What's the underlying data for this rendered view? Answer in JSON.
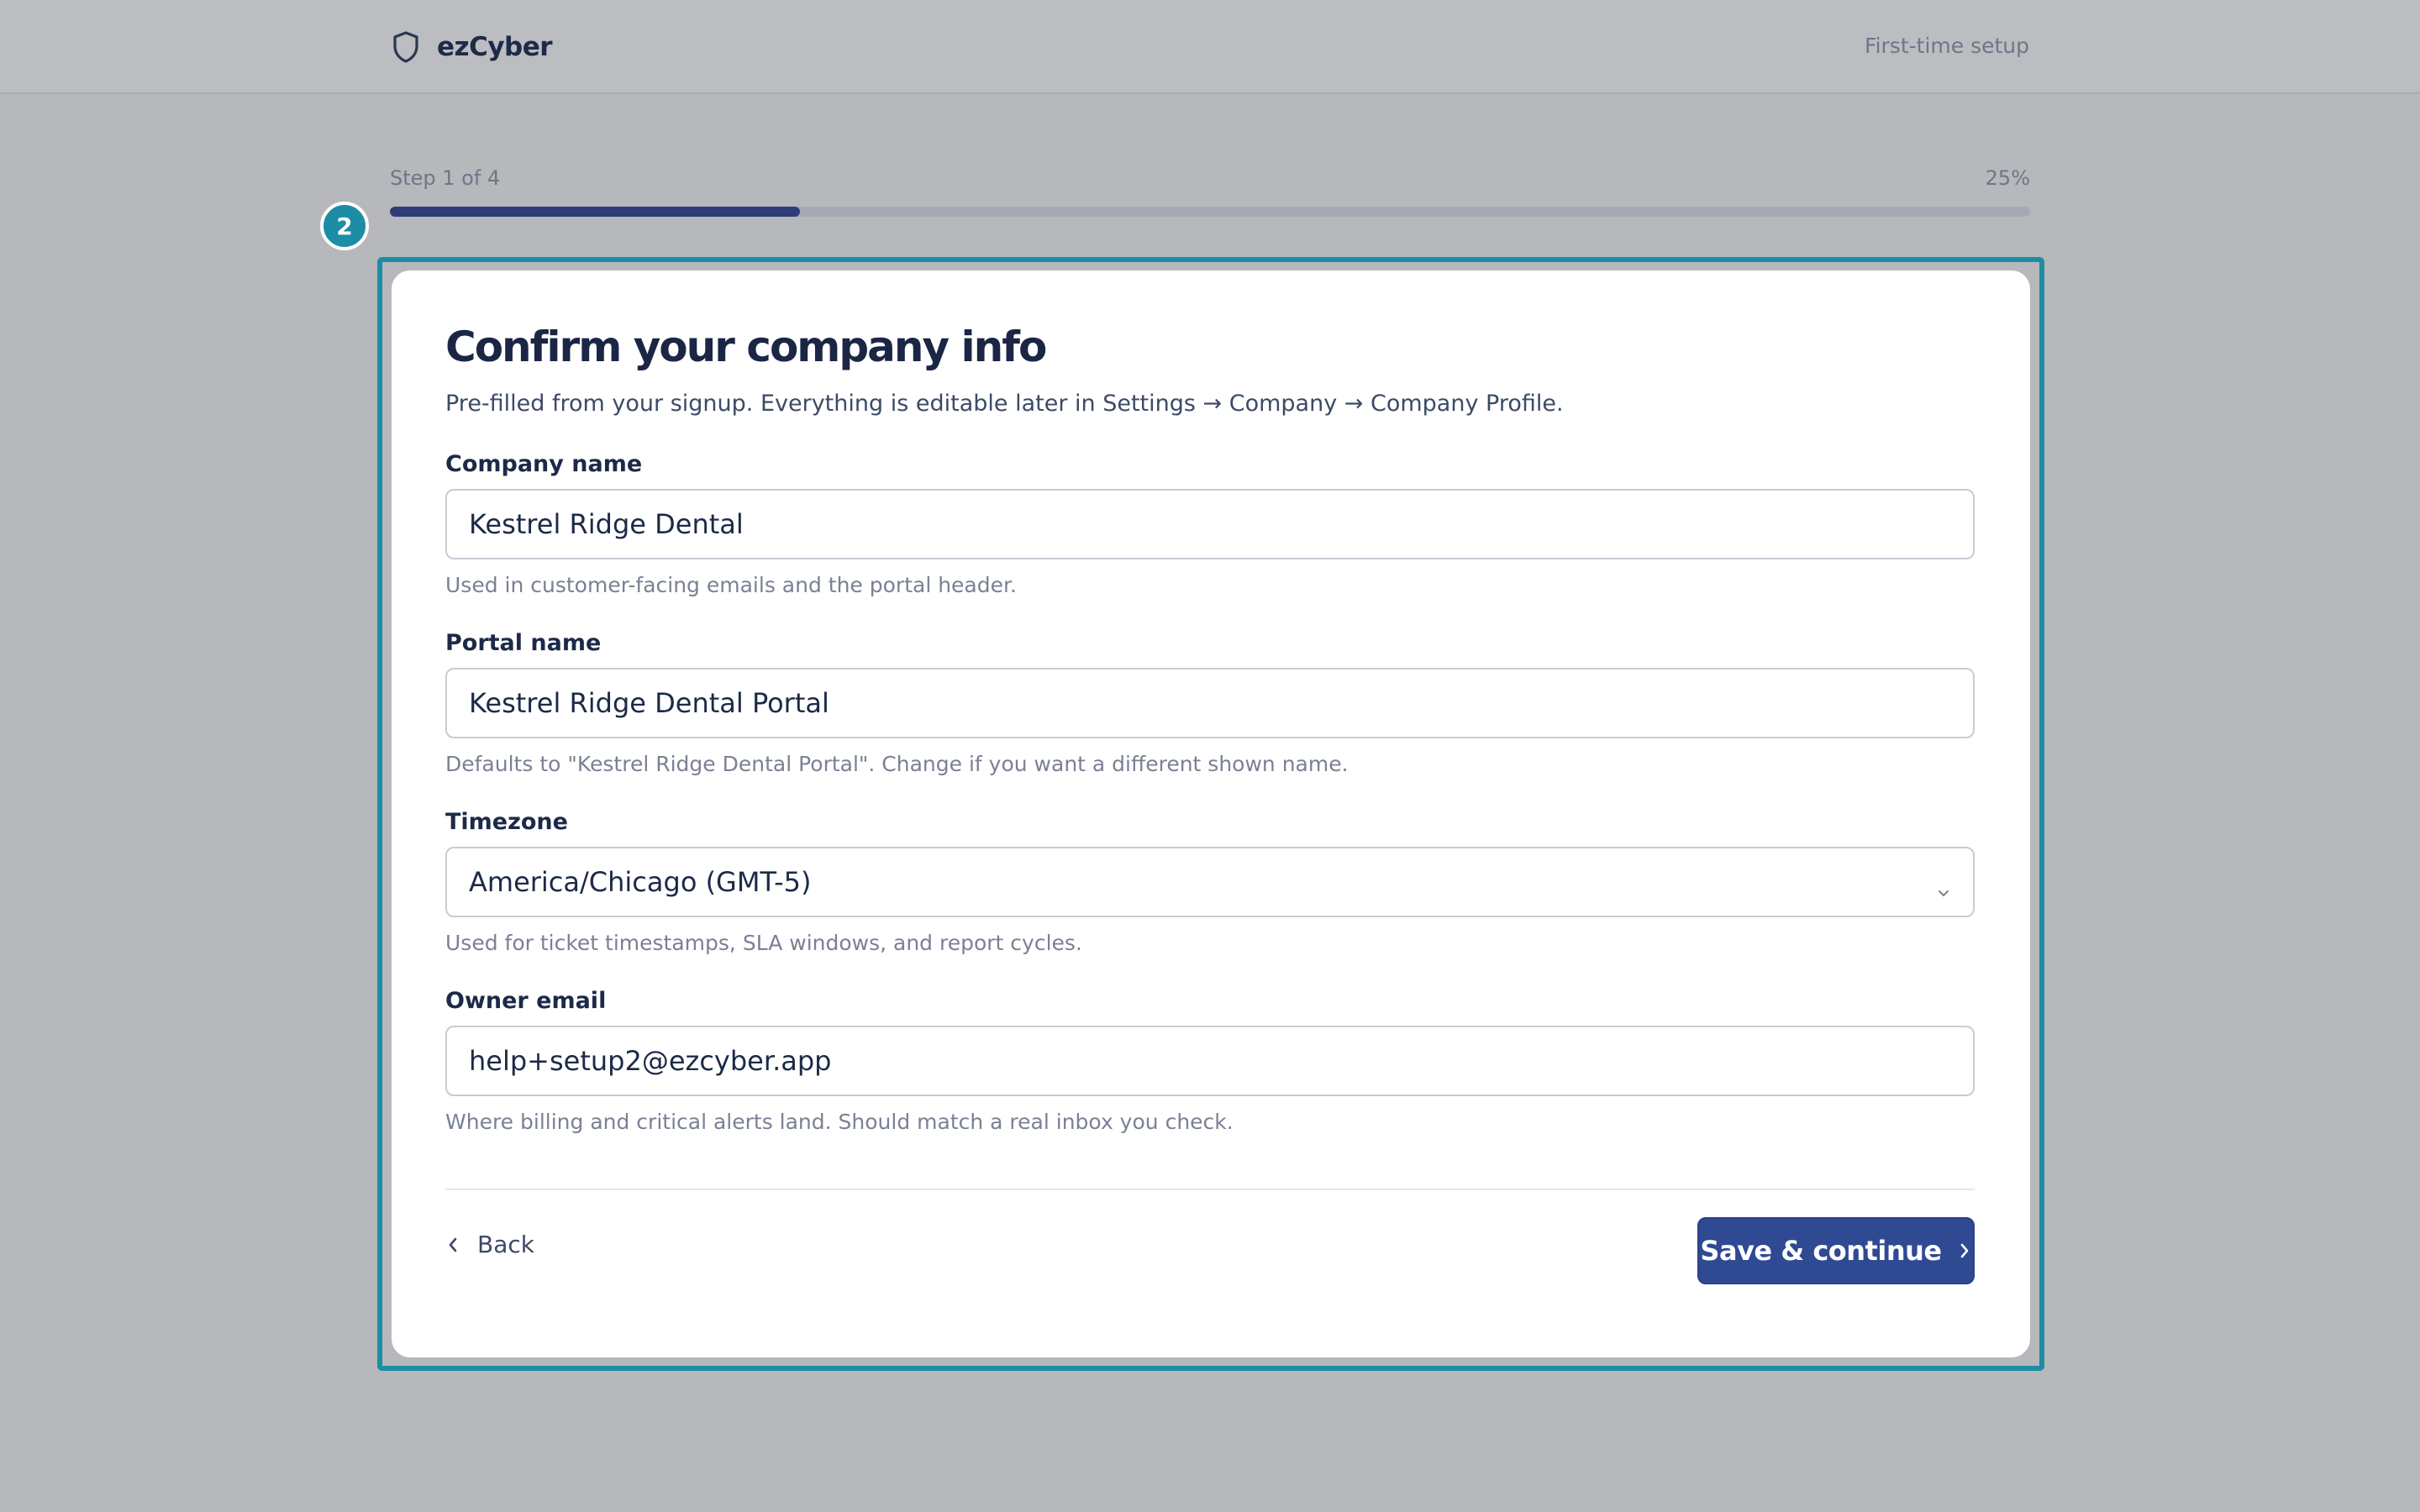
{
  "header": {
    "brand_name": "ezCyber",
    "setup_label": "First-time setup"
  },
  "progress": {
    "step_text": "Step 1 of 4",
    "percent_text": "25%",
    "fraction": 0.25
  },
  "annotation": {
    "badge_number": "2",
    "color": "#1c8da5"
  },
  "form": {
    "title": "Confirm your company info",
    "subtitle": "Pre-filled from your signup. Everything is editable later in Settings → Company → Company Profile.",
    "fields": [
      {
        "label": "Company name",
        "value": "Kestrel Ridge Dental",
        "hint": "Used in customer-facing emails and the portal header."
      },
      {
        "label": "Portal name",
        "value": "Kestrel Ridge Dental Portal",
        "hint": "Defaults to \"Kestrel Ridge Dental Portal\". Change if you want a different shown name."
      },
      {
        "label": "Timezone",
        "value": "America/Chicago (GMT-5)",
        "hint": "Used for ticket timestamps, SLA windows, and report cycles."
      },
      {
        "label": "Owner email",
        "value": "help+setup2@ezcyber.app",
        "hint": "Where billing and critical alerts land. Should match a real inbox you check."
      }
    ]
  },
  "actions": {
    "back_label": "Back",
    "save_label": "Save & continue"
  },
  "icons": {
    "brand": "shield-icon",
    "timezone": "chevron-down-icon",
    "back": "chevron-left-icon",
    "save": "chevron-right-icon"
  },
  "colors": {
    "primary": "#2f4a93",
    "progress_fill": "#2c3d77",
    "highlight": "#1c8da5"
  }
}
